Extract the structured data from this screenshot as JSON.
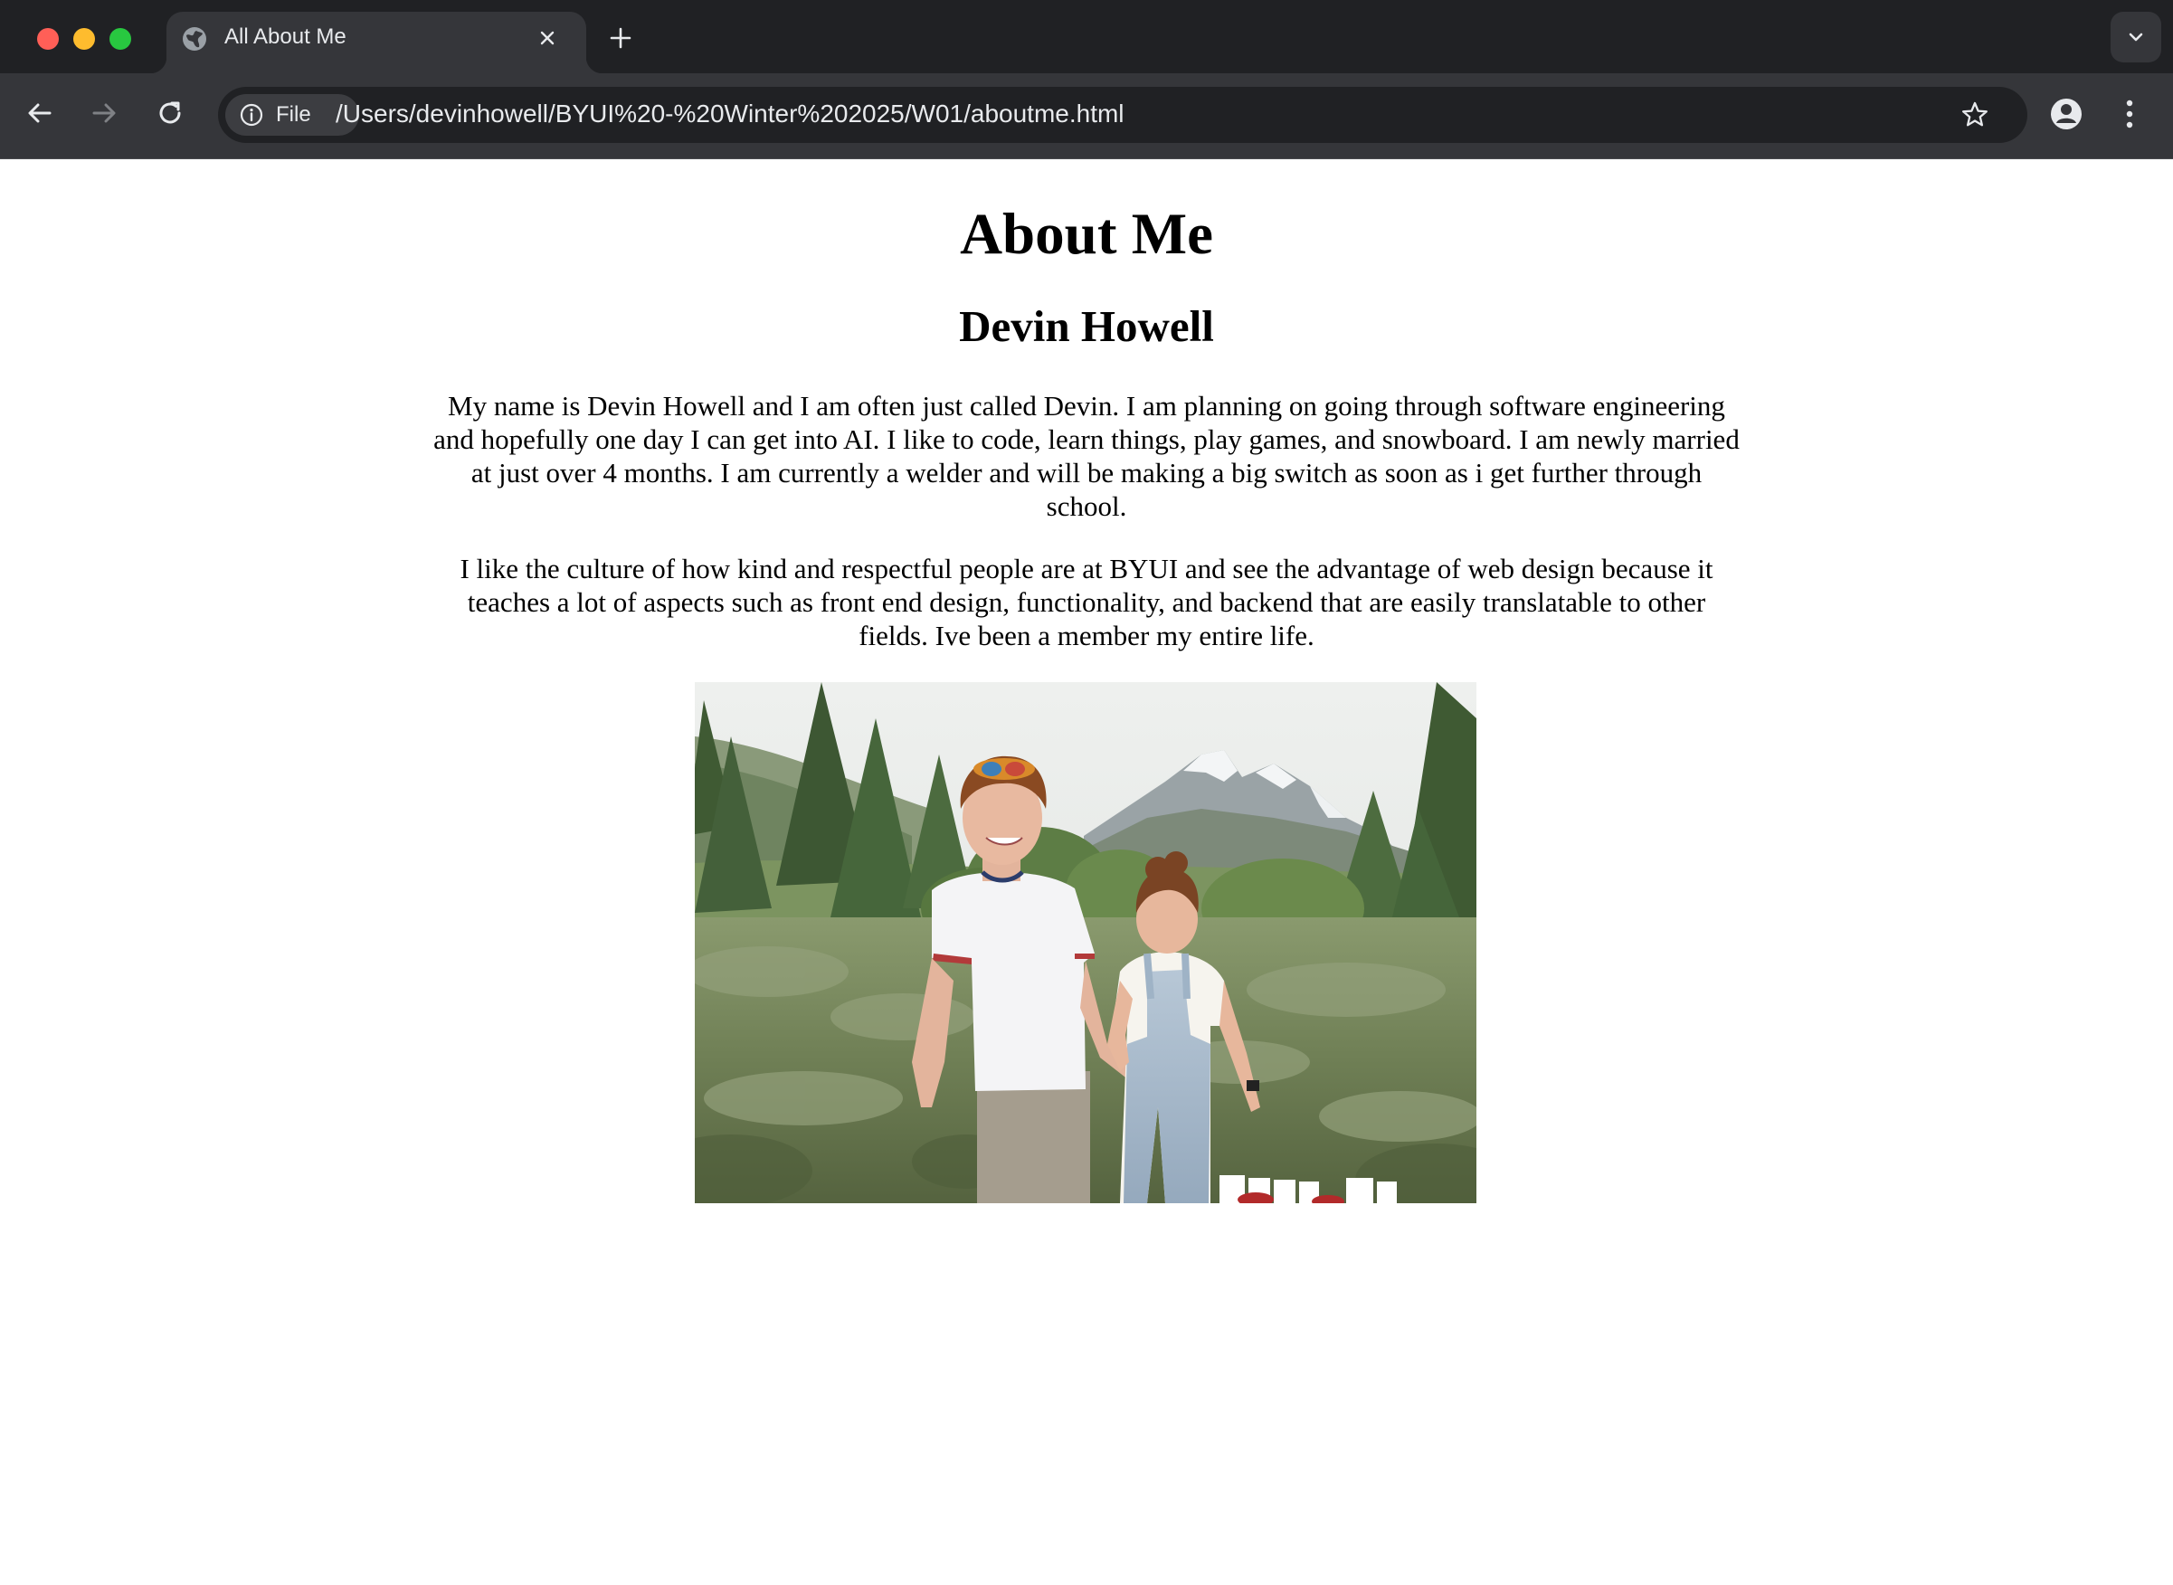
{
  "browser": {
    "tab": {
      "title": "All About Me",
      "favicon": "globe-icon"
    },
    "toolbar": {
      "site_chip_label": "File",
      "url": "/Users/devinhowell/BYUI%20-%20Winter%202025/W01/aboutme.html"
    },
    "icons": {
      "back": "arrow-left-icon",
      "forward": "arrow-right-icon",
      "reload": "reload-icon",
      "info": "info-icon",
      "star": "star-icon",
      "profile": "profile-icon",
      "menu": "kebab-menu-icon",
      "new_tab": "plus-icon",
      "tab_search": "chevron-down-icon",
      "tab_close": "close-icon"
    },
    "colors": {
      "tabstrip": "#202124",
      "toolbar": "#35363a",
      "close": "#ff5f57",
      "minimize": "#febc2e",
      "maximize": "#28c840"
    }
  },
  "page": {
    "heading": "About Me",
    "subheading": "Devin Howell",
    "paragraphs": [
      "My name is Devin Howell and I am often just called Devin. I am planning on going through software engineering and hopefully one day I can get into AI. I like to code, learn things, play games, and snowboard. I am newly married at just over 4 months. I am currently a welder and will be making a big switch as soon as i get further through school.",
      "I like the culture of how kind and respectful people are at BYUI and see the advantage of web design because it teaches a lot of aspects such as front end design, functionality, and backend that are easily translatable to other fields. Ive been a member my entire life."
    ]
  }
}
